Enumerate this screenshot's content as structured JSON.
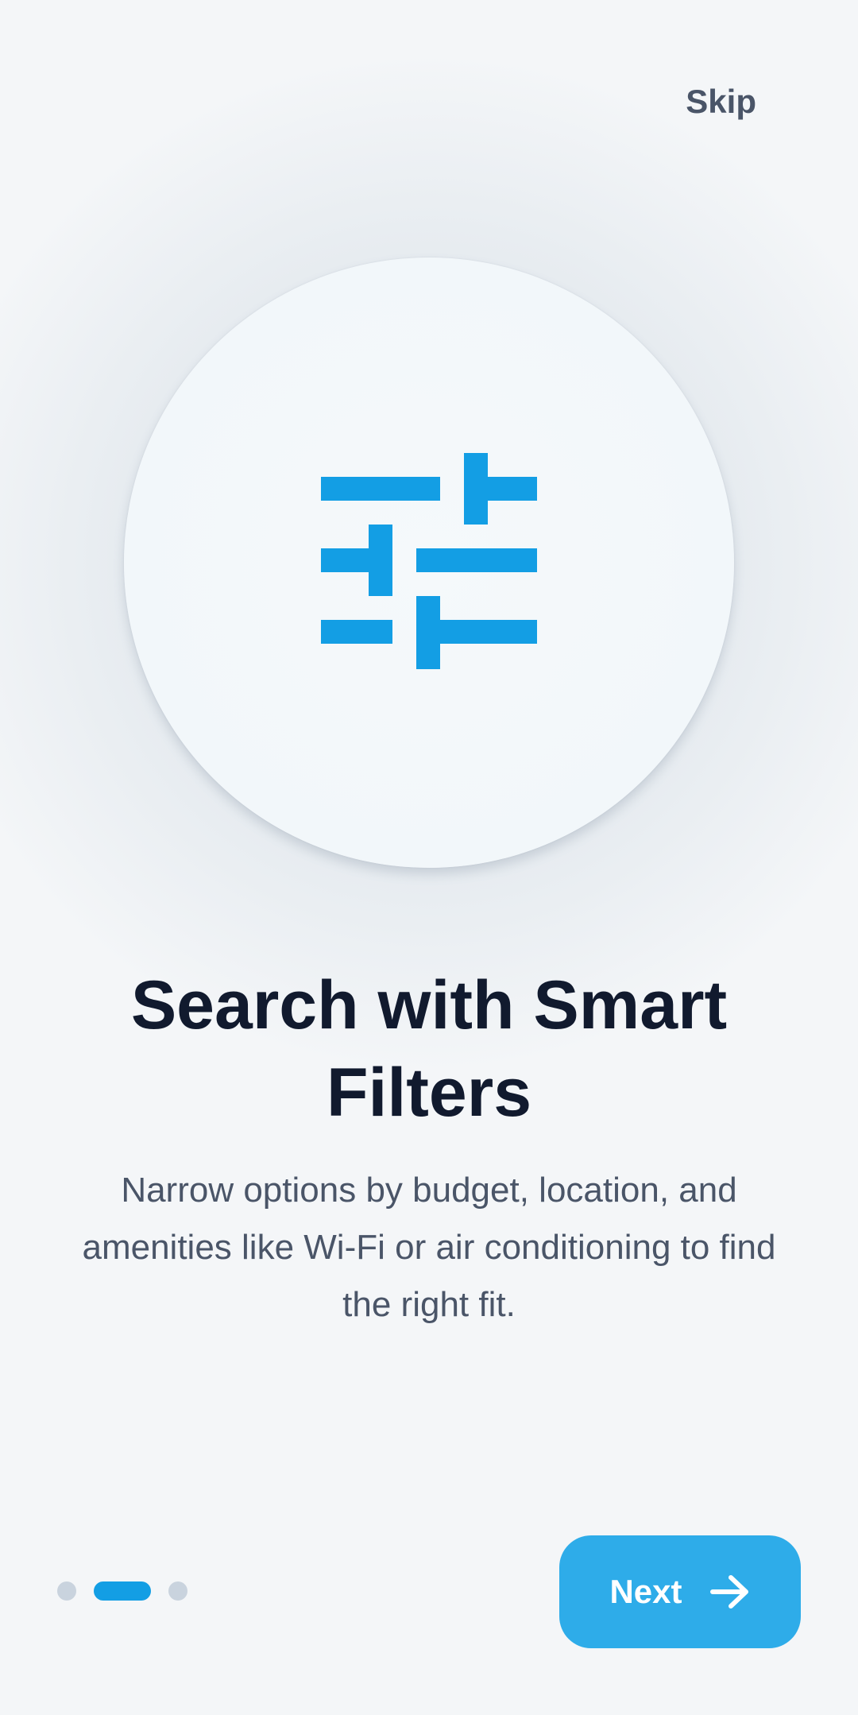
{
  "header": {
    "skip_label": "Skip"
  },
  "hero": {
    "icon": "sliders-filter-icon",
    "icon_color": "#139ee4"
  },
  "content": {
    "title": "Search with Smart Filters",
    "description": "Narrow options by budget, location, and amenities like Wi-Fi or air conditioning to find the right fit."
  },
  "pagination": {
    "total_pages": 3,
    "current_page": 2,
    "active_color": "#139ee4",
    "inactive_color": "#c9d3de"
  },
  "footer": {
    "next_label": "Next",
    "next_icon": "arrow-right-icon",
    "button_color": "#2eace9"
  },
  "colors": {
    "background": "#f4f6f8",
    "title_text": "#111a2e",
    "body_text": "#4a5568"
  }
}
